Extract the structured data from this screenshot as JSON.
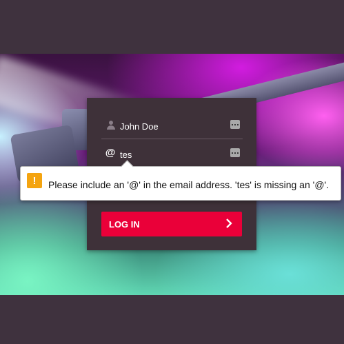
{
  "form": {
    "name_value": "John Doe",
    "email_value": "tes",
    "at_symbol": "@",
    "login_label": "LOG IN"
  },
  "validation": {
    "message": "Please include an '@' in the email address. 'tes' is missing an '@'.",
    "warning_glyph": "!"
  },
  "colors": {
    "page_bg": "#3f323e",
    "card_bg": "#3e3139",
    "button": "#ea0039",
    "warning": "#f4a410"
  },
  "icons": {
    "name_field": "person-icon",
    "email_field": "at-icon",
    "field_menu": "autofill-menu-icon",
    "button": "chevron-right-icon",
    "tooltip": "warning-icon"
  }
}
